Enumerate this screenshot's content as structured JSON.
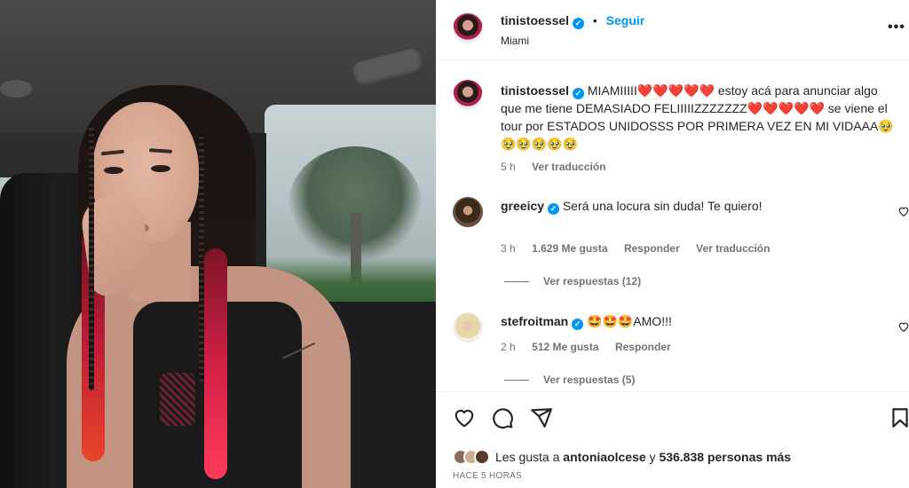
{
  "post": {
    "author": "tinistoessel",
    "follow_label": "Seguir",
    "location": "Miami",
    "more_label": "•••"
  },
  "caption": {
    "author": "tinistoessel",
    "text": "MIAMIIIII❤️❤️❤️❤️❤️ estoy acá para anunciar algo que me tiene DEMASIADO FELIIIIIZZZZZZZ❤️❤️❤️❤️❤️ se viene el tour por ESTADOS UNIDOSSS POR PRIMERA VEZ EN MI VIDAAA🥹🥹🥹🥹🥹🥹",
    "time": "5 h",
    "translate": "Ver traducción"
  },
  "comments": [
    {
      "author": "greeicy",
      "text": "Será una locura sin duda! Te quiero!",
      "time": "3 h",
      "likes": "1.629 Me gusta",
      "reply": "Responder",
      "translate": "Ver traducción",
      "replies": "Ver respuestas (12)"
    },
    {
      "author": "stefroitman",
      "text": "🤩🤩🤩AMO!!!",
      "time": "2 h",
      "likes": "512 Me gusta",
      "reply": "Responder",
      "replies": "Ver respuestas (5)"
    }
  ],
  "likes_summary": {
    "prefix": "Les gusta a ",
    "user": "antoniaolcese",
    "middle": " y ",
    "count": "536.838 personas más"
  },
  "time_ago": "HACE 5 HORAS",
  "icons": {
    "like": "heart-icon",
    "comment": "comment-icon",
    "share": "share-icon",
    "save": "bookmark-icon",
    "verified": "verified-badge-icon"
  },
  "colors": {
    "accent": "#0095f6",
    "text": "#262626",
    "muted": "#737373"
  }
}
